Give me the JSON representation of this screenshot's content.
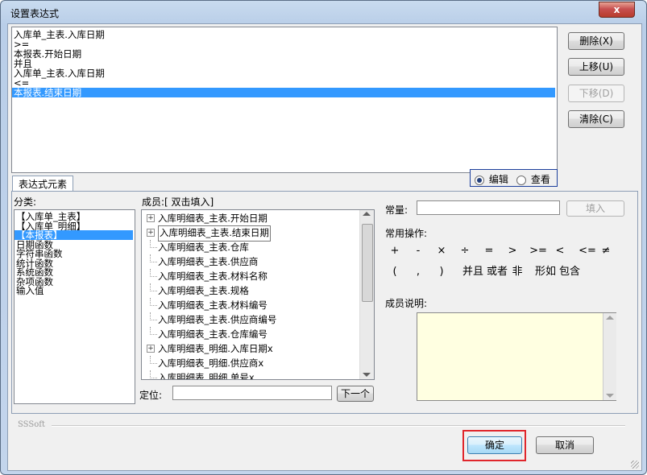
{
  "window": {
    "title": "设置表达式",
    "close_label": "x"
  },
  "expression_lines": [
    "入库单_主表.入库日期",
    ">=",
    "本报表.开始日期",
    "并且",
    "入库单_主表.入库日期",
    "<=",
    "本报表.结束日期"
  ],
  "selected_line": 6,
  "side_buttons": {
    "delete": "删除(X)",
    "move_up": "上移(U)",
    "move_down": "下移(D)",
    "clear": "清除(C)"
  },
  "mode": {
    "edit": "编辑",
    "view": "查看",
    "selected": "edit"
  },
  "tab_label": "表达式元素",
  "category": {
    "label": "分类:",
    "items": [
      "【入库单_主表】",
      "【入库单_明细】",
      "【本报表】",
      "日期函数",
      "字符串函数",
      "统计函数",
      "系统函数",
      "杂项函数",
      "输入值"
    ],
    "selected": 2
  },
  "members": {
    "label": "成员:[ 双击填入]",
    "items": [
      {
        "text": "入库明细表_主表.开始日期",
        "expandable": true
      },
      {
        "text": "入库明细表_主表.结束日期",
        "expandable": true
      },
      {
        "text": "入库明细表_主表.仓库",
        "expandable": false
      },
      {
        "text": "入库明细表_主表.供应商",
        "expandable": false
      },
      {
        "text": "入库明细表_主表.材料名称",
        "expandable": false
      },
      {
        "text": "入库明细表_主表.规格",
        "expandable": false
      },
      {
        "text": "入库明细表_主表.材料编号",
        "expandable": false
      },
      {
        "text": "入库明细表_主表.供应商编号",
        "expandable": false
      },
      {
        "text": "入库明细表_主表.仓库编号",
        "expandable": false
      },
      {
        "text": "入库明细表_明细.入库日期x",
        "expandable": true
      },
      {
        "text": "入库明细表_明细.供应商x",
        "expandable": false
      },
      {
        "text": "入库明细表_明细.单号x",
        "expandable": false
      }
    ],
    "focused": 1
  },
  "locate": {
    "label": "定位:",
    "value": "",
    "next_label": "下一个"
  },
  "constant": {
    "label": "常量:",
    "value": "",
    "fill_label": "填入"
  },
  "ops": {
    "label": "常用操作:",
    "row1": [
      "+",
      "-",
      "×",
      "÷",
      "=",
      ">",
      ">=",
      "<",
      "<=",
      "≠"
    ],
    "row2": [
      "(",
      ",",
      ")",
      "并且",
      "或者",
      "非",
      "形如",
      "包含"
    ]
  },
  "member_desc": {
    "label": "成员说明:",
    "text": ""
  },
  "footer": {
    "brand": "SSSoft",
    "ok": "确定",
    "cancel": "取消"
  },
  "colors": {
    "selection": "#3399ff",
    "highlight_box": "#e0262c",
    "desc_bg": "#ffffe1"
  }
}
